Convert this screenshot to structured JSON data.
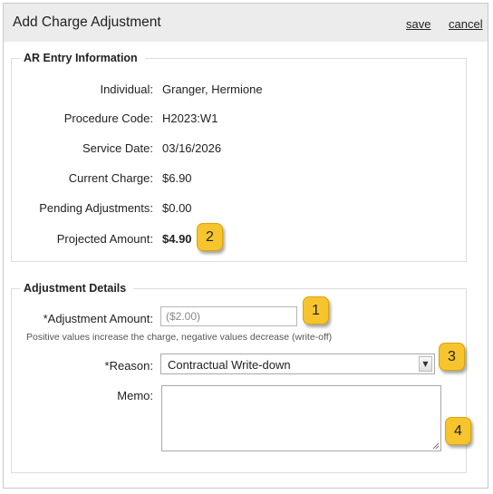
{
  "dialog": {
    "title": "Add Charge Adjustment",
    "save_label": "save",
    "cancel_label": "cancel"
  },
  "ar_entry": {
    "legend": "AR Entry Information",
    "fields": [
      {
        "label": "Individual:",
        "value": "Granger, Hermione"
      },
      {
        "label": "Procedure Code:",
        "value": "H2023:W1"
      },
      {
        "label": "Service Date:",
        "value": "03/16/2026"
      },
      {
        "label": "Current Charge:",
        "value": "$6.90"
      },
      {
        "label": "Pending Adjustments:",
        "value": "$0.00"
      },
      {
        "label": "Projected Amount:",
        "value": "$4.90"
      }
    ]
  },
  "adjustment": {
    "legend": "Adjustment Details",
    "amount_label": "*Adjustment Amount:",
    "amount_value": "($2.00)",
    "hint": "Positive values increase the charge, negative values decrease (write-off)",
    "reason_label": "*Reason:",
    "reason_value": "Contractual Write-down",
    "memo_label": "Memo:",
    "memo_value": ""
  },
  "badges": [
    "1",
    "2",
    "3",
    "4"
  ],
  "colors": {
    "badge": "#f6c52e",
    "titlebar": "#ececec"
  }
}
